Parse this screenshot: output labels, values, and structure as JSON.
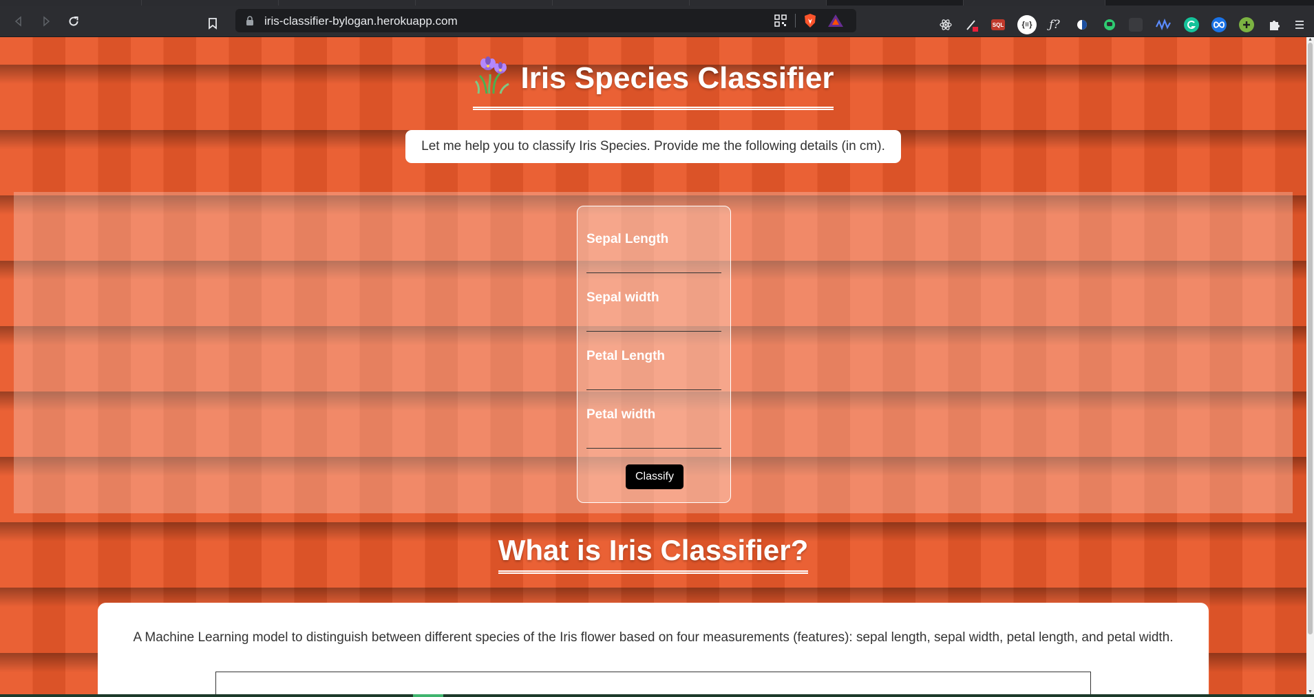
{
  "browser": {
    "url": "iris-classifier-bylogan.herokuapp.com",
    "colors": {
      "chrome": "#2c2d31",
      "urlbar": "#1c1d20",
      "text": "#e8eaed"
    },
    "icons": [
      "back-icon",
      "forward-icon",
      "reload-icon",
      "bookmark-icon",
      "lock-icon",
      "qr-code-icon",
      "brave-shield-icon",
      "brave-rewards-icon",
      "react-devtools-icon",
      "eyedropper-icon",
      "sql-icon",
      "json-viewer-icon",
      "formula-icon",
      "dark-reader-icon",
      "chat-extension-icon",
      "wave-extension-icon",
      "grammarly-icon",
      "loop-extension-icon",
      "add-extension-icon",
      "extensions-puzzle-icon",
      "menu-icon"
    ],
    "extensions": {
      "sql": "SQL",
      "json": "{≡}",
      "formula": "ƒ?"
    }
  },
  "header": {
    "title": "Iris Species Classifier",
    "intro": "Let me help you to classify Iris Species. Provide me the following details (in cm)."
  },
  "form": {
    "fields": [
      {
        "label": "Sepal Length",
        "value": ""
      },
      {
        "label": "Sepal width",
        "value": ""
      },
      {
        "label": "Petal Length",
        "value": ""
      },
      {
        "label": "Petal width",
        "value": ""
      }
    ],
    "submit_label": "Classify"
  },
  "about": {
    "title": "What is Iris Classifier?",
    "description": "A Machine Learning model to distinguish between different species of the Iris flower based on four measurements (features): sepal length, sepal width, petal length, and petal width."
  },
  "theme": {
    "background": "#e9582a",
    "button": "#000000",
    "card": "#ffffff"
  }
}
